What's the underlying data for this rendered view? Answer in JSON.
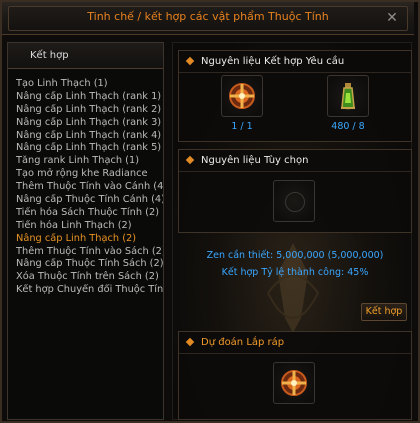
{
  "window": {
    "title": "Tinh chế / kết hợp các vật phẩm Thuộc Tính",
    "close_label": "✕"
  },
  "left_panel": {
    "header": "Kết hợp",
    "items": [
      "Tạo Linh Thạch (1)",
      "Nâng cấp Linh Thạch (rank 1)",
      "Nâng cấp Linh Thạch (rank 2)",
      "Nâng cấp Linh Thạch (rank 3)",
      "Nâng cấp Linh Thạch (rank 4)",
      "Nâng cấp Linh Thạch (rank 5)",
      "Tăng rank Linh Thạch (1)",
      "Tạo mở rộng khe Radiance",
      "Thêm Thuộc Tính vào Cánh (4",
      "Nâng cấp Thuộc Tính Cánh (4)",
      "Tiến hóa Sách Thuộc Tính (2)",
      "Tiến hóa Linh Thạch (2)",
      "Nâng cấp Linh Thạch (2)",
      "Thêm Thuộc Tính vào Sách (2)",
      "Nâng cấp Thuộc Tính Sách (2)",
      "Xóa Thuộc Tính trên Sách (2)",
      "Kết hợp Chuyển đổi Thuộc Tín"
    ],
    "active_index": 12
  },
  "required": {
    "title": "Nguyên liệu Kết hợp Yêu cầu",
    "slots": [
      {
        "icon": "orb-cross-icon",
        "count": "1 / 1"
      },
      {
        "icon": "green-potion-icon",
        "count": "480 / 8"
      }
    ]
  },
  "optional": {
    "title": "Nguyên liệu Tùy chọn"
  },
  "info": {
    "zen": "Zen cần thiết: 5,000,000 (5,000,000)",
    "rate": "Kết hợp Tỷ lệ thành công: 45%"
  },
  "combine_button": "Kết hợp",
  "prediction": {
    "title": "Dự đoán Lắp ráp",
    "result_icon": "orb-cross-icon"
  },
  "colors": {
    "accent": "#e8821e",
    "highlight": "#e89323",
    "info_blue": "#3aa7ff"
  }
}
